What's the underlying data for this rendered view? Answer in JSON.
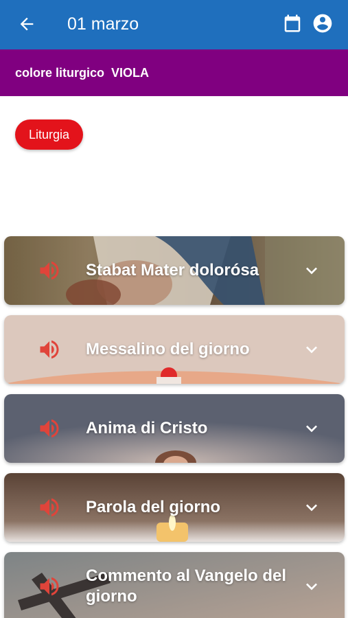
{
  "appbar": {
    "title": "01 marzo",
    "back_icon": "arrow-back-icon",
    "calendar_icon": "calendar-icon",
    "account_icon": "account-circle-icon",
    "color": "#1f6fbd"
  },
  "liturgical_color": {
    "label": "colore liturgico",
    "value": "VIOLA",
    "color": "#800080"
  },
  "chip": {
    "label": "Liturgia",
    "color": "#e3131b"
  },
  "cards": [
    {
      "title": "Stabat Mater dolorósa",
      "speaker_icon": "speaker-icon",
      "chevron_icon": "chevron-down-icon"
    },
    {
      "title": "Messalino del giorno",
      "speaker_icon": "speaker-icon",
      "chevron_icon": "chevron-down-icon"
    },
    {
      "title": "Anima di Cristo",
      "speaker_icon": "speaker-icon",
      "chevron_icon": "chevron-down-icon"
    },
    {
      "title": "Parola del giorno",
      "speaker_icon": "speaker-icon",
      "chevron_icon": "chevron-down-icon"
    },
    {
      "title": "Commento al Vangelo del giorno",
      "speaker_icon": "speaker-icon",
      "chevron_icon": "chevron-down-icon"
    }
  ],
  "accent_speaker": "#e0443a"
}
